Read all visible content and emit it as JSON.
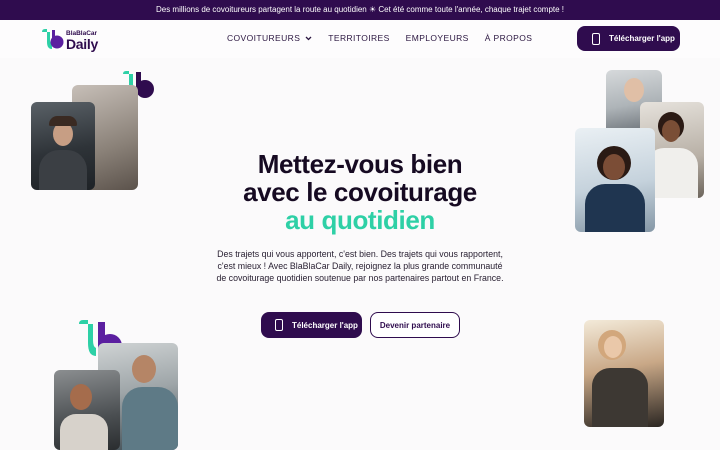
{
  "banner": {
    "text": "Des millions de covoitureurs partagent la route au quotidien ☀ Cet été comme toute l'année, chaque trajet compte !"
  },
  "brand": {
    "top": "BlaBlaCar",
    "main": "Daily"
  },
  "nav": {
    "items": [
      {
        "label": "COVOITUREURS",
        "has_dropdown": true
      },
      {
        "label": "TERRITOIRES"
      },
      {
        "label": "EMPLOYEURS"
      },
      {
        "label": "À PROPOS"
      }
    ]
  },
  "cta": {
    "download": "Télécharger l'app",
    "partner": "Devenir partenaire"
  },
  "hero": {
    "title_line1": "Mettez-vous bien",
    "title_line2": "avec le covoiturage",
    "title_accent": "au quotidien",
    "subtitle": "Des trajets qui vous apportent, c'est bien. Des trajets qui vous rapportent, c'est mieux ! Avec BlaBlaCar Daily, rejoignez la plus grande communauté de covoiturage quotidien soutenue par nos partenaires partout en France."
  },
  "colors": {
    "brand_dark": "#2f0c4e",
    "accent": "#2ed0a6",
    "purple": "#5b1fa0"
  }
}
